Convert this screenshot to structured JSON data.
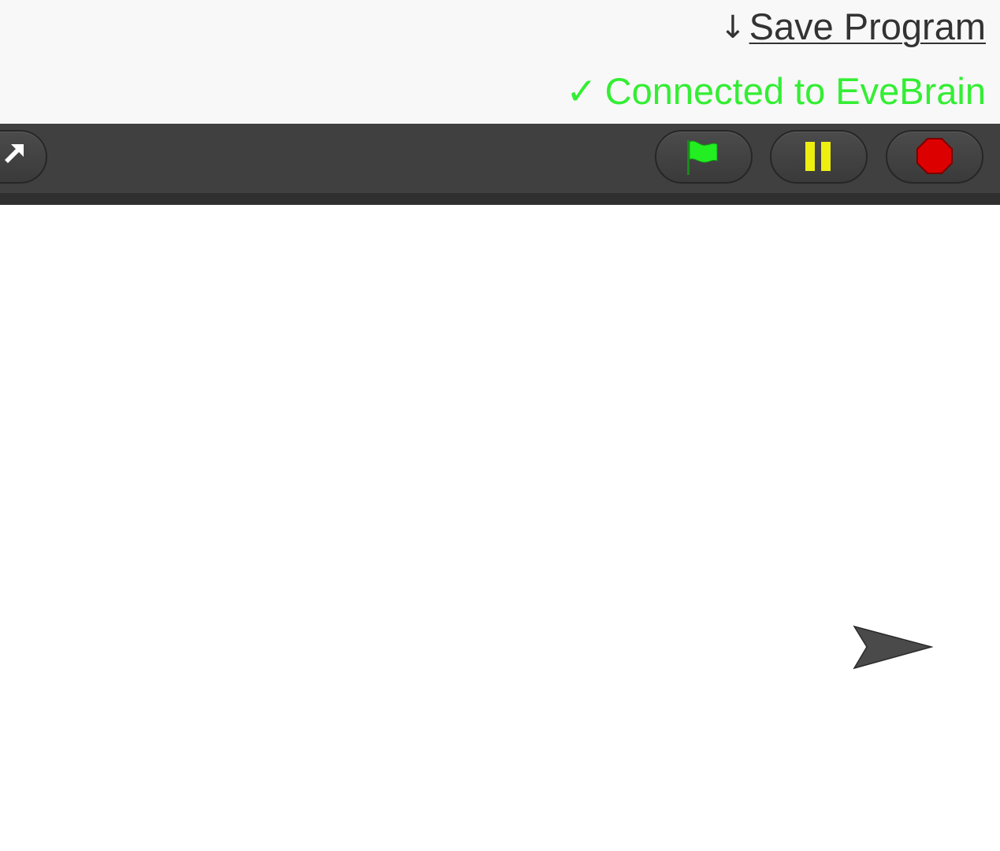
{
  "header": {
    "save_arrow": "↓",
    "save_label": "Save Program",
    "status_check": "✓",
    "status_label": "Connected to EveBrain",
    "status_color": "#33ee33"
  },
  "toolbar": {
    "buttons": [
      {
        "name": "fullscreen",
        "icon": "fullscreen-arrow-icon"
      },
      {
        "name": "go",
        "icon": "green-flag-icon",
        "color": "#22ee22"
      },
      {
        "name": "pause",
        "icon": "pause-icon",
        "color": "#eeee11"
      },
      {
        "name": "stop",
        "icon": "stop-octagon-icon",
        "color": "#dd0000"
      }
    ]
  },
  "stage": {
    "turtle_icon": "turtle-arrow-icon",
    "turtle_color": "#4a4a4a"
  }
}
